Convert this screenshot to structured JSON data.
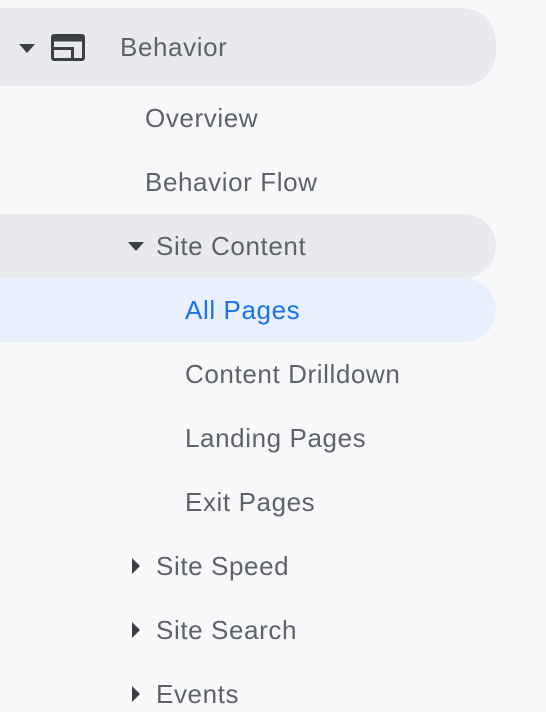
{
  "nav": {
    "section": {
      "label": "Behavior",
      "icon": "behavior-icon",
      "expanded": true
    },
    "items": [
      {
        "label": "Overview"
      },
      {
        "label": "Behavior Flow"
      }
    ],
    "site_content": {
      "label": "Site Content",
      "expanded": true,
      "children": [
        {
          "label": "All Pages",
          "active": true
        },
        {
          "label": "Content Drilldown"
        },
        {
          "label": "Landing Pages"
        },
        {
          "label": "Exit Pages"
        }
      ]
    },
    "collapsed_groups": [
      {
        "label": "Site Speed"
      },
      {
        "label": "Site Search"
      },
      {
        "label": "Events"
      }
    ]
  },
  "colors": {
    "background": "#f8f9fa",
    "hover_grey": "#e8eaed",
    "active_bg": "#e8f0fe",
    "active_text": "#1a73e8",
    "text": "#5f6368",
    "icon": "#3c4043"
  }
}
